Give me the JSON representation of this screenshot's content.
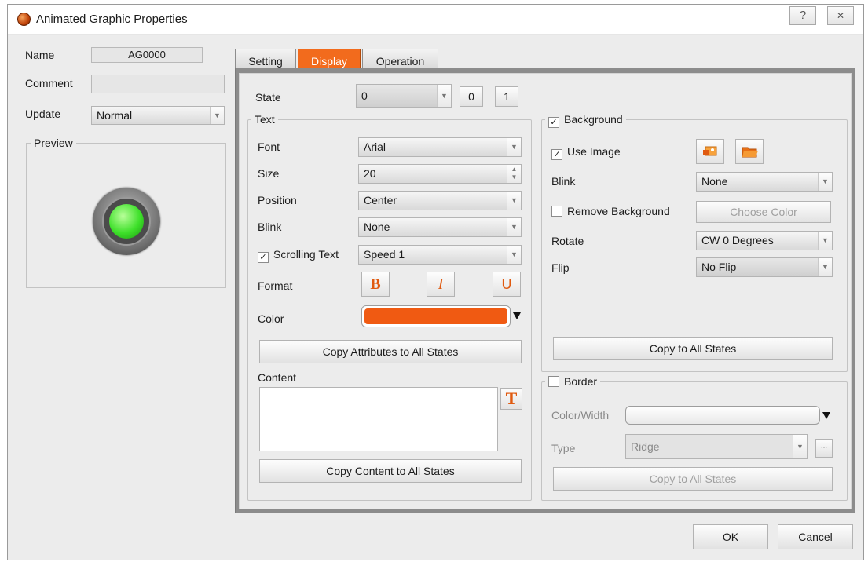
{
  "window": {
    "title": "Animated Graphic Properties",
    "help_glyph": "?",
    "close_glyph": "✕"
  },
  "left": {
    "name_label": "Name",
    "name_value": "AG0000",
    "comment_label": "Comment",
    "comment_value": "",
    "update_label": "Update",
    "update_value": "Normal",
    "preview_label": "Preview"
  },
  "tabs": [
    {
      "label": "Setting"
    },
    {
      "label": "Display"
    },
    {
      "label": "Operation"
    }
  ],
  "state": {
    "label": "State",
    "value": "0",
    "buttons": [
      "0",
      "1"
    ]
  },
  "text_group": {
    "title": "Text",
    "font_label": "Font",
    "font_value": "Arial",
    "size_label": "Size",
    "size_value": "20",
    "position_label": "Position",
    "position_value": "Center",
    "blink_label": "Blink",
    "blink_value": "None",
    "scrolling_label": "Scrolling Text",
    "scrolling_checked": true,
    "scrolling_value": "Speed 1",
    "format_label": "Format",
    "bold_glyph": "B",
    "italic_glyph": "I",
    "underline_glyph": "U",
    "color_label": "Color",
    "color_value": "#f05a12",
    "copy_attributes_label": "Copy Attributes to All States",
    "content_label": "Content",
    "content_value": "",
    "text_insert_glyph": "T",
    "copy_content_label": "Copy Content to All States"
  },
  "background_group": {
    "title": "Background",
    "checked": true,
    "use_image_label": "Use Image",
    "use_image_checked": true,
    "blink_label": "Blink",
    "blink_value": "None",
    "remove_bg_label": "Remove Background",
    "remove_bg_checked": false,
    "choose_color_label": "Choose Color",
    "rotate_label": "Rotate",
    "rotate_value": "CW 0 Degrees",
    "flip_label": "Flip",
    "flip_value": "No Flip",
    "copy_label": "Copy to All States"
  },
  "border_group": {
    "title": "Border",
    "checked": false,
    "color_width_label": "Color/Width",
    "type_label": "Type",
    "type_value": "Ridge",
    "more_glyph": "...",
    "copy_label": "Copy to All States"
  },
  "footer": {
    "ok_label": "OK",
    "cancel_label": "Cancel"
  },
  "colors": {
    "accent": "#f26b1d",
    "text_color_swatch": "#f05a12",
    "lamp_on": "#3ee02a"
  }
}
